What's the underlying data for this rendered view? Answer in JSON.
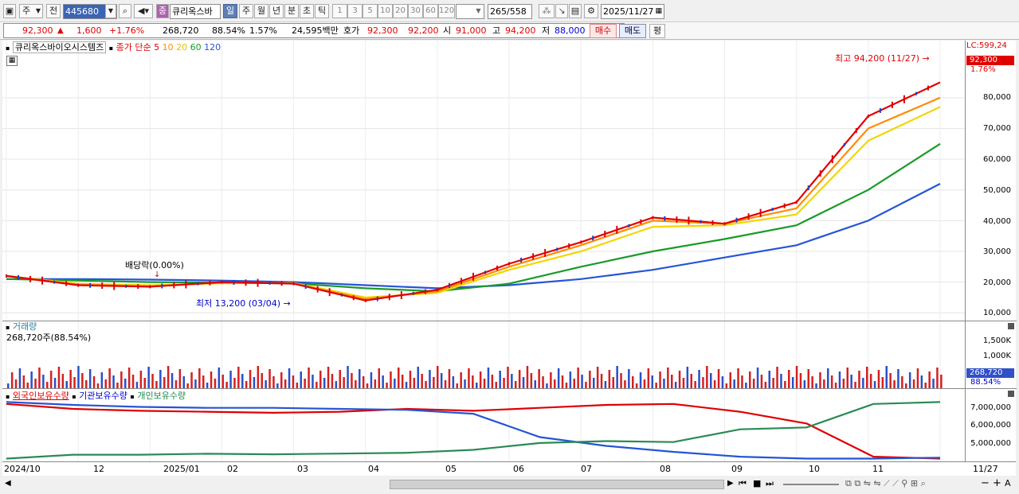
{
  "toolbar": {
    "market_select": "주",
    "market_prev": "전",
    "code": "445680",
    "type_badge": "종",
    "name": "큐리옥스바",
    "periods": [
      "일",
      "주",
      "월",
      "년",
      "분",
      "초",
      "틱"
    ],
    "selected_period": "일",
    "intervals": [
      "1",
      "3",
      "5",
      "10",
      "20",
      "30",
      "60",
      "120"
    ],
    "count": "265",
    "total": "/558",
    "date": "2025/11/27"
  },
  "quote": {
    "price": "92,300",
    "change": "1,600",
    "change_pct": "+1.76%",
    "volume": "268,720",
    "vol_ratio": "88.54%",
    "turnover": "1.57%",
    "amount": "24,595백만",
    "bid_label": "호가",
    "ask": "92,300",
    "bid": "92,200",
    "open_label": "시",
    "open": "91,000",
    "high_label": "고",
    "high": "94,200",
    "low_label": "저",
    "low": "88,000",
    "buy_label": "매수",
    "sell_label": "매도",
    "eval_label": "평"
  },
  "price_panel": {
    "name_tag": "큐리옥스바이오시스템즈",
    "ma_label": "종가 단순",
    "ma_periods": [
      "5",
      "10",
      "20",
      "60",
      "120"
    ],
    "ma_colors": [
      "#e00000",
      "#ff8c00",
      "#f2d600",
      "#1a9a2a",
      "#2455d6"
    ],
    "high_note": "최고 94,200 (11/27)",
    "low_note": "최저 13,200 (03/04)",
    "dividend_note": "배당락(0.00%)",
    "lc_label": "LC:599,24",
    "price_tag": "92,300",
    "pct_tag": "1.76%",
    "y_ticks": [
      "80,000",
      "70,000",
      "60,000",
      "50,000",
      "40,000",
      "30,000",
      "20,000",
      "10,000"
    ]
  },
  "volume_panel": {
    "title": "거래량",
    "value": "268,720주(88.54%)",
    "y_ticks": [
      "1,500K",
      "1,000K"
    ],
    "tag_value": "268,720",
    "tag_pct": "88.54%"
  },
  "holdings_panel": {
    "legend": [
      "외국인보유수량",
      "기관보유수량",
      "개인보유수량"
    ],
    "y_ticks": [
      "7,000,000",
      "6,000,000",
      "5,000,000"
    ]
  },
  "x_axis": {
    "labels": [
      "2024/10",
      "12",
      "2025/01",
      "02",
      "03",
      "04",
      "05",
      "06",
      "07",
      "08",
      "09",
      "10",
      "11"
    ],
    "end_label": "11/27"
  },
  "chart_data": {
    "type": "line",
    "title": "큐리옥스바이오시스템즈",
    "x": [
      "2024/10",
      "11",
      "12",
      "2025/01",
      "02",
      "03",
      "04",
      "05",
      "06",
      "07",
      "08",
      "09",
      "10",
      "11/27"
    ],
    "series": [
      {
        "name": "5",
        "values": [
          22000,
          19000,
          18500,
          20000,
          19500,
          14000,
          17500,
          26000,
          33000,
          41000,
          39000,
          46000,
          74000,
          85000
        ]
      },
      {
        "name": "10",
        "values": [
          22000,
          19200,
          18600,
          19800,
          19600,
          14500,
          17000,
          25000,
          32000,
          40000,
          39000,
          44000,
          70000,
          80000
        ]
      },
      {
        "name": "20",
        "values": [
          22000,
          19500,
          19000,
          19600,
          19700,
          15000,
          16500,
          24000,
          30000,
          38000,
          38500,
          42000,
          66000,
          77000
        ]
      },
      {
        "name": "60",
        "values": [
          21000,
          20500,
          20000,
          19800,
          19600,
          18000,
          17000,
          19500,
          25000,
          30000,
          34000,
          38500,
          50000,
          65000
        ]
      },
      {
        "name": "120",
        "values": [
          21000,
          21000,
          20800,
          20500,
          20000,
          19000,
          18000,
          19000,
          21000,
          24000,
          28000,
          32000,
          40000,
          52000
        ]
      }
    ],
    "ylabel": "",
    "ylim": [
      8000,
      96000
    ],
    "volume": {
      "name": "거래량",
      "ylim": [
        0,
        1900000
      ]
    },
    "holdings": [
      {
        "name": "외국인보유수량",
        "values": [
          7300000,
          7050000,
          6950000,
          6900000,
          6850000,
          6900000,
          7050000,
          6950000,
          7100000,
          7250000,
          7300000,
          6900000,
          6300000,
          4600000,
          4500000
        ]
      },
      {
        "name": "기관보유수량",
        "values": [
          7400000,
          7250000,
          7150000,
          7100000,
          7100000,
          7050000,
          7000000,
          6800000,
          5600000,
          5150000,
          4850000,
          4600000,
          4500000,
          4500000,
          4550000
        ]
      },
      {
        "name": "개인보유수량",
        "values": [
          4500000,
          4700000,
          4700000,
          4750000,
          4720000,
          4760000,
          4800000,
          4950000,
          5300000,
          5400000,
          5350000,
          6000000,
          6100000,
          7300000,
          7400000
        ]
      }
    ],
    "holdings_ylim": [
      4400000,
      7700000
    ],
    "grid": true,
    "legend": "top-left"
  }
}
